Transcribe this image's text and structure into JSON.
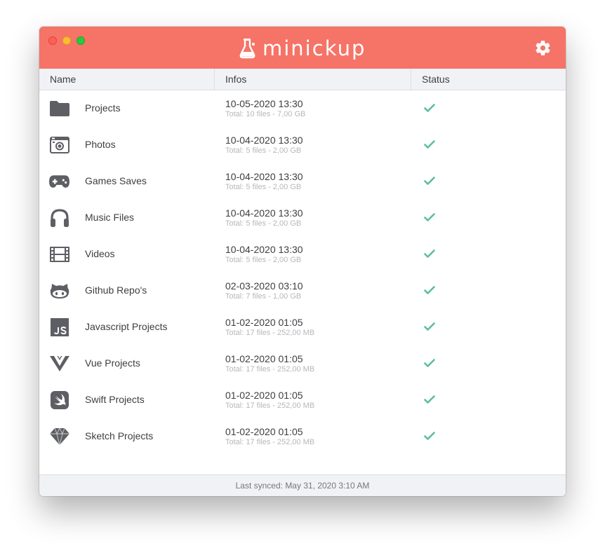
{
  "app": {
    "title": "minickup",
    "brand_color": "#f67367",
    "icon": "flask-icon",
    "settings_icon": "gear-icon"
  },
  "columns": {
    "name": "Name",
    "infos": "Infos",
    "status": "Status"
  },
  "rows": [
    {
      "icon": "folder-icon",
      "name": "Projects",
      "date": "10-05-2020 13:30",
      "total": "Total: 10 files - 7,00 GB",
      "status": "check-icon"
    },
    {
      "icon": "camera-icon",
      "name": "Photos",
      "date": "10-04-2020 13:30",
      "total": "Total: 5 files - 2,00 GB",
      "status": "check-icon"
    },
    {
      "icon": "gamepad-icon",
      "name": "Games Saves",
      "date": "10-04-2020 13:30",
      "total": "Total: 5 files - 2,00 GB",
      "status": "check-icon"
    },
    {
      "icon": "headphones-icon",
      "name": "Music Files",
      "date": "10-04-2020 13:30",
      "total": "Total: 5 files - 2,00 GB",
      "status": "check-icon"
    },
    {
      "icon": "film-icon",
      "name": "Videos",
      "date": "10-04-2020 13:30",
      "total": "Total: 5 files - 2,00 GB",
      "status": "check-icon"
    },
    {
      "icon": "github-icon",
      "name": "Github Repo's",
      "date": "02-03-2020 03:10",
      "total": "Total: 7 files - 1,00 GB",
      "status": "check-icon"
    },
    {
      "icon": "javascript-icon",
      "name": "Javascript Projects",
      "date": "01-02-2020 01:05",
      "total": "Total: 17 files - 252,00 MB",
      "status": "check-icon"
    },
    {
      "icon": "vue-icon",
      "name": "Vue Projects",
      "date": "01-02-2020 01:05",
      "total": "Total: 17 files - 252,00 MB",
      "status": "check-icon"
    },
    {
      "icon": "swift-icon",
      "name": "Swift Projects",
      "date": "01-02-2020 01:05",
      "total": "Total: 17 files - 252,00 MB",
      "status": "check-icon"
    },
    {
      "icon": "sketch-icon",
      "name": "Sketch Projects",
      "date": "01-02-2020 01:05",
      "total": "Total: 17 files - 252,00 MB",
      "status": "check-icon"
    }
  ],
  "footer": {
    "last_synced": "Last synced: May 31, 2020 3:10 AM"
  },
  "colors": {
    "status_ok": "#5bbf95",
    "icon_gray": "#5e5f64"
  }
}
